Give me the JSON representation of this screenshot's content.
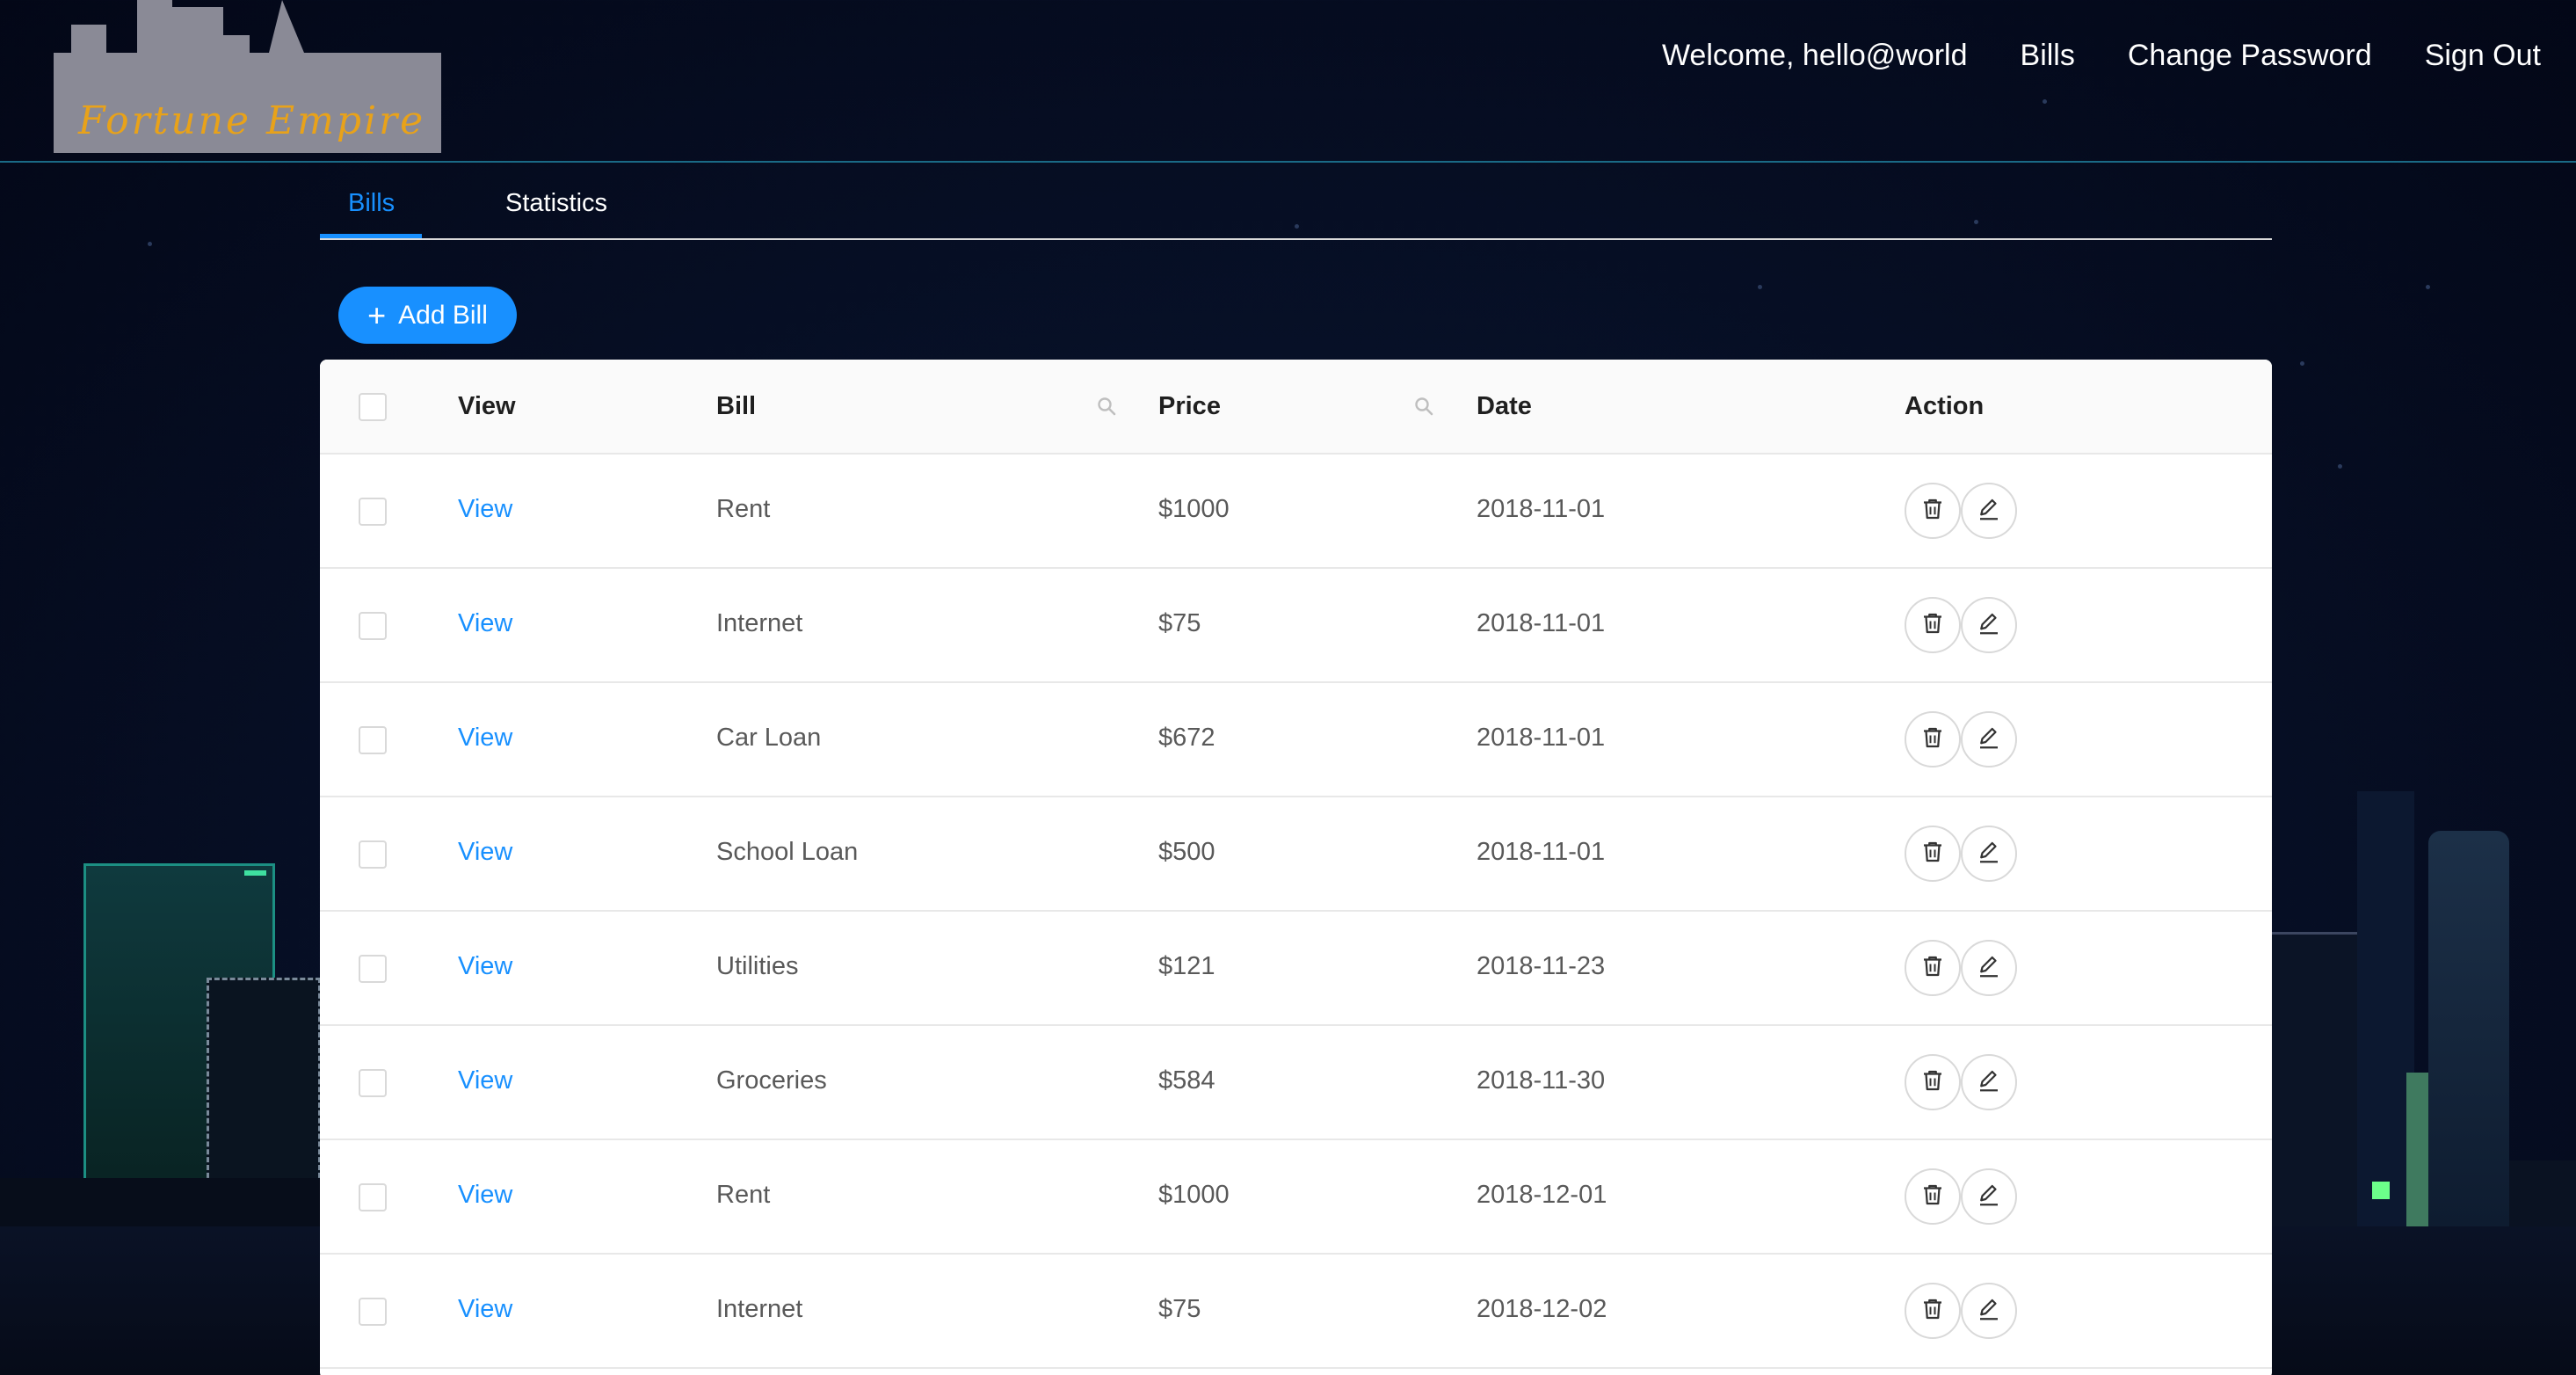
{
  "header": {
    "logo_text": "Fortune Empire",
    "nav": {
      "welcome": "Welcome, hello@world",
      "bills": "Bills",
      "change_password": "Change Password",
      "sign_out": "Sign Out"
    }
  },
  "tabs": [
    {
      "label": "Bills",
      "active": true
    },
    {
      "label": "Statistics",
      "active": false
    }
  ],
  "add_button": {
    "label": "Add Bill",
    "icon": "plus-icon"
  },
  "table": {
    "columns": {
      "view": "View",
      "bill": "Bill",
      "price": "Price",
      "date": "Date",
      "action": "Action"
    },
    "rows": [
      {
        "view": "View",
        "bill": "Rent",
        "price": "$1000",
        "date": "2018-11-01"
      },
      {
        "view": "View",
        "bill": "Internet",
        "price": "$75",
        "date": "2018-11-01"
      },
      {
        "view": "View",
        "bill": "Car Loan",
        "price": "$672",
        "date": "2018-11-01"
      },
      {
        "view": "View",
        "bill": "School Loan",
        "price": "$500",
        "date": "2018-11-01"
      },
      {
        "view": "View",
        "bill": "Utilities",
        "price": "$121",
        "date": "2018-11-23"
      },
      {
        "view": "View",
        "bill": "Groceries",
        "price": "$584",
        "date": "2018-11-30"
      },
      {
        "view": "View",
        "bill": "Rent",
        "price": "$1000",
        "date": "2018-12-01"
      },
      {
        "view": "View",
        "bill": "Internet",
        "price": "$75",
        "date": "2018-12-02"
      }
    ],
    "row_actions": [
      "delete-icon",
      "edit-icon"
    ]
  },
  "colors": {
    "accent": "#1890ff",
    "logo_gold": "#e8a21a",
    "background": "#071027"
  }
}
